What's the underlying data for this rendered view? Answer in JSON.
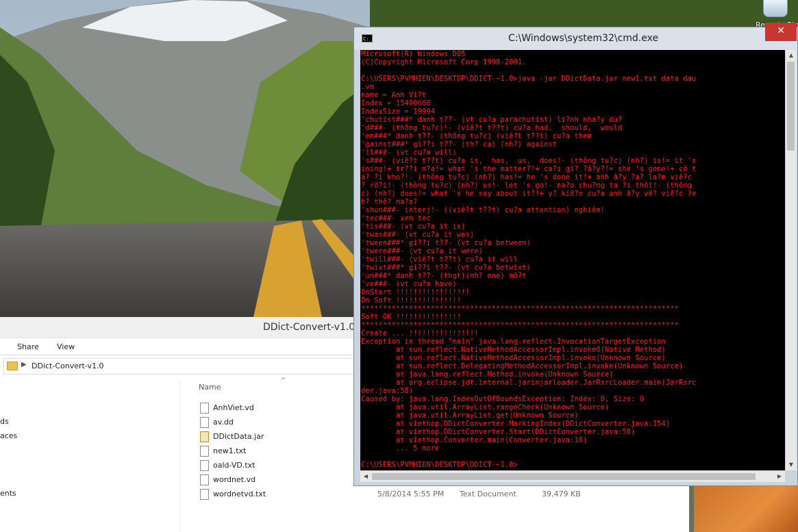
{
  "desktop": {
    "recycle_bin_label": "Recycle Bin"
  },
  "explorer": {
    "title": "DDict-Convert-v1.0",
    "ribbon": {
      "share": "Share",
      "view": "View"
    },
    "address": "DDict-Convert-v1.0",
    "nav_fragments": [
      "ds",
      "aces",
      "ents"
    ],
    "column_name": "Name",
    "files": [
      {
        "name": "AnhViet.vd",
        "date": "",
        "type": "",
        "size": "",
        "icon": "file"
      },
      {
        "name": "av.dd",
        "date": "",
        "type": "",
        "size": "",
        "icon": "file"
      },
      {
        "name": "DDictData.jar",
        "date": "",
        "type": "",
        "size": "",
        "icon": "jar"
      },
      {
        "name": "new1.txt",
        "date": "",
        "type": "",
        "size": "",
        "icon": "txt"
      },
      {
        "name": "oald-VD.txt",
        "date": "",
        "type": "",
        "size": "",
        "icon": "txt"
      },
      {
        "name": "wordnet.vd",
        "date": "",
        "type": "",
        "size": "",
        "icon": "file"
      },
      {
        "name": "wordnetvd.txt",
        "date": "5/8/2014 5:55 PM",
        "type": "Text Document",
        "size": "39,479 KB",
        "icon": "txt"
      }
    ]
  },
  "cmd": {
    "title": "C:\\Windows\\system32\\cmd.exe",
    "close_glyph": "✕",
    "text_color": "#ff1a1a",
    "lines": [
      "Microsoft(R) Windows DOS",
      "(C)Copyright Microsoft Corp 1990-2001.",
      "",
      "C:\\USERS\\PVMHIEN\\DESKTOP\\DDICT-~1.0>java -jar DDictData.jar new1.txt data dau",
      ".vn",
      "name = Anh Vi?t",
      "Index = 15490666",
      "IndexSize = 19994",
      "'chutist###* danh t??- (vt cu?a parachutist) li?nh nha?y du?",
      "'d###- (thông tu?c)!- (viê?t t??t) cu?a had,  should,  would",
      "'em###* danh t??- (thông tu?c) (viê?t t??t) cu?a them",
      "'gainst###* gi??i t??- (th? ca) (nh?) against",
      "'ll###- (vt cu?a will)",
      "'s###- (viê?t t??t) cu?a is,  has,  us,  does!- (thông tu?c) (nh?) is!= it 's",
      "ining!+ tr??i m?a!= what 's the matter?!+ ca?i gi? ?â?y?!= she 's gone!+ cô t",
      "a? ?i kho?!- (thông tu?c) (nh?) has!= he 's done it!+ anh â?y ?a? la?m viê?c",
      "? rô?i!- (thông tu?c) (nh?) us!- let 's go!- na?o chu?ng ta ?i thôi!- (thông",
      "c) (nh?) does!= what 's he say about it?!+ y? kiê?n cu?a anh â?y vê? viê?c ?e",
      "h? thê? na?o?",
      "'shun###- interj!- ((viê?t t??t) cu?a attention) nghiêm!",
      "'tec###- xem tec",
      "'tis###- (vt cu?a it is)",
      "'twas###- (vt cu?a it was)",
      "'tween###* gi??i t??- (vt cu?a between)",
      "'twere###- (vt cu?a it were)",
      "'twill###- (viê?t t??t) cu?a it will",
      "'twixt###* gi??i t??- (vt cu?a betwixt)",
      "'un###* danh t??- (thgt)(nh? one) mô?t",
      "'ve###- (vt cu?a have)",
      "OnStart !!!!!!!!!!!!!!!!!",
      "On Soft !!!!!!!!!!!!!!!",
      "*************************************************************************",
      "Soft OK !!!!!!!!!!!!!!!",
      "*************************************************************************",
      "Create ... !!!!!!!!!!!!!!!!",
      "Exception in thread \"main\" java.lang.reflect.InvocationTargetException",
      "        at sun.reflect.NativeMethodAccessorImpl.invoke0(Native Method)",
      "        at sun.reflect.NativeMethodAccessorImpl.invoke(Unknown Source)",
      "        at sun.reflect.DelegatingMethodAccessorImpl.invoke(Unknown Source)",
      "        at java.lang.reflect.Method.invoke(Unknown Source)",
      "        at org.eclipse.jdt.internal.jarinjarloader.JarRsrcLoader.main(JarRsrc",
      "der.java:58)",
      "Caused by: java.lang.IndexOutOfBoundsException: Index: 0, Size: 0",
      "        at java.util.ArrayList.rangeCheck(Unknown Source)",
      "        at java.util.ArrayList.get(Unknown Source)",
      "        at viethop.DDictConverter.MarkingIndex(DDictConverter.java:154)",
      "        at viethop.DDictConverter.Start(DDictConverter.java:50)",
      "        at viethop.Converter.main(Converter.java:16)",
      "        ... 5 more",
      "",
      "C:\\USERS\\PVMHIEN\\DESKTOP\\DDICT-~1.0>"
    ]
  }
}
